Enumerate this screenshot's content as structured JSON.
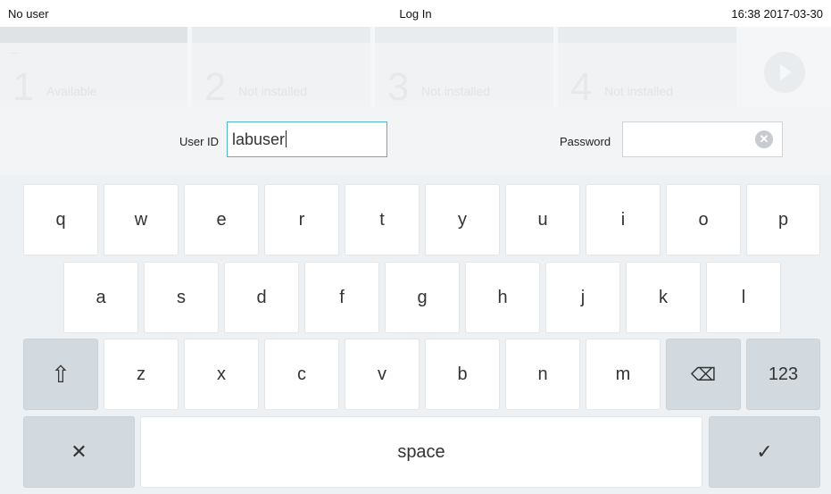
{
  "status_bar": {
    "user": "No user",
    "title": "Log In",
    "datetime": "16:38 2017-03-30"
  },
  "modules": [
    {
      "number": "1",
      "status": "Available"
    },
    {
      "number": "2",
      "status": "Not installed"
    },
    {
      "number": "3",
      "status": "Not installed"
    },
    {
      "number": "4",
      "status": "Not installed"
    }
  ],
  "module_dash": "----",
  "login": {
    "user_id_label": "User ID",
    "user_id_value": "labuser",
    "password_label": "Password",
    "password_value": ""
  },
  "keyboard": {
    "row1": [
      "q",
      "w",
      "e",
      "r",
      "t",
      "y",
      "u",
      "i",
      "o",
      "p"
    ],
    "row2": [
      "a",
      "s",
      "d",
      "f",
      "g",
      "h",
      "j",
      "k",
      "l"
    ],
    "row3": [
      "z",
      "x",
      "c",
      "v",
      "b",
      "n",
      "m"
    ],
    "numbers_label": "123",
    "space_label": "space",
    "shift_icon": "⇧",
    "backspace_icon": "⌫",
    "cancel_icon": "✕",
    "confirm_icon": "✓"
  }
}
